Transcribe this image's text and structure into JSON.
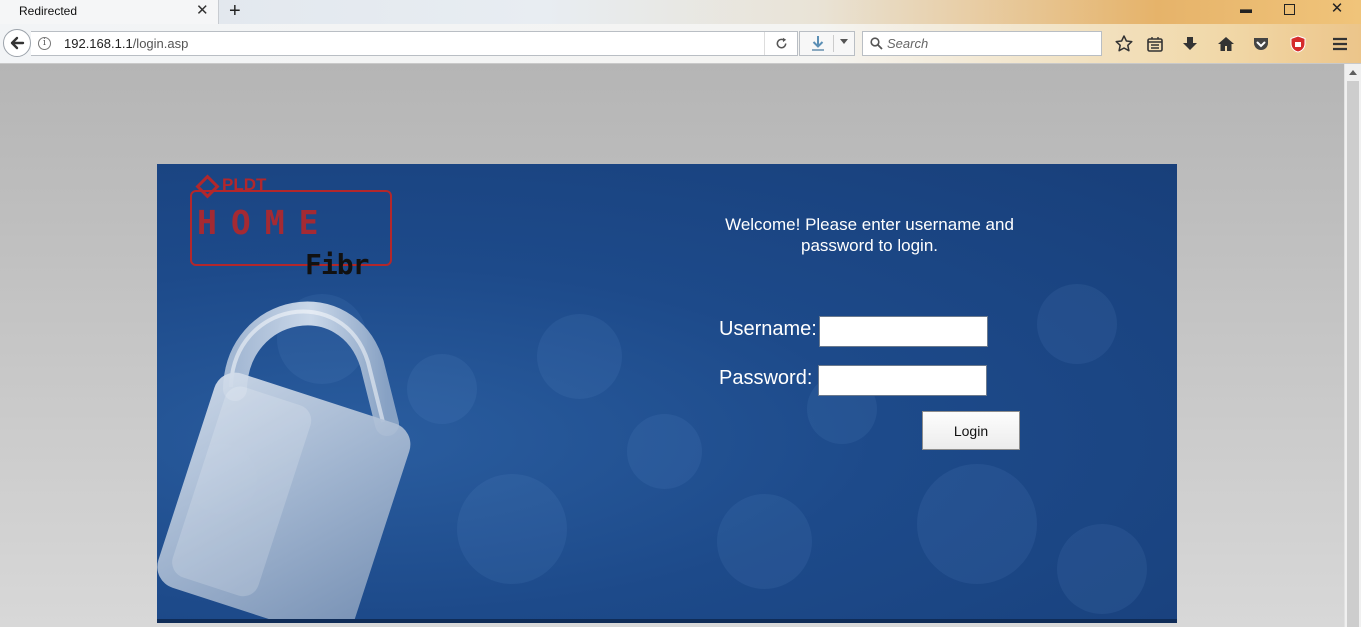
{
  "browser": {
    "tab_title": "Redirected",
    "url_host": "192.168.1.1",
    "url_path": "/login.asp",
    "search_placeholder": "Search",
    "icons": [
      "back-icon",
      "info-icon",
      "reload-icon",
      "download-icon",
      "search-icon",
      "bookmark-star-icon",
      "reading-list-icon",
      "downloads-icon",
      "home-icon",
      "pocket-icon",
      "shield-addon-icon",
      "menu-icon",
      "minimize-icon",
      "restore-icon",
      "close-icon"
    ]
  },
  "login": {
    "welcome_line1": "Welcome! Please enter username and",
    "welcome_line2": "password to login.",
    "username_label": "Username:",
    "password_label": "Password:",
    "username_value": "",
    "password_value": "",
    "login_button": "Login"
  },
  "logo": {
    "brand": "PLDT",
    "product": "HOME",
    "sub": "Fibr"
  },
  "colors": {
    "panel_blue": "#1d4a8a",
    "logo_red": "#b3272b",
    "page_grey": "#bdbdbd"
  }
}
